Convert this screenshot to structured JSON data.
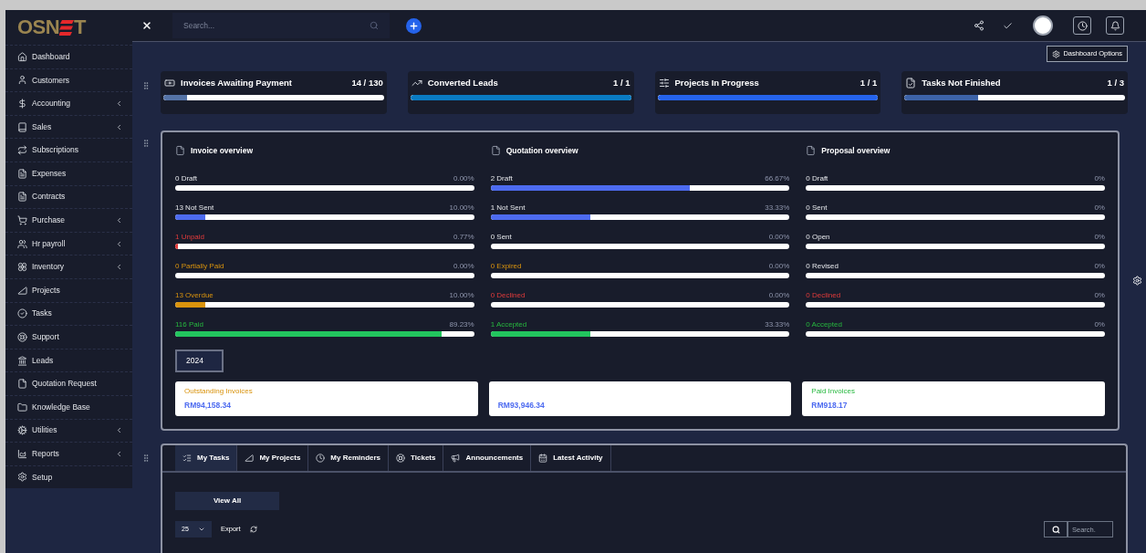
{
  "logo": {
    "left": "OSN",
    "right": "T"
  },
  "sidebar": {
    "items": [
      {
        "label": "Dashboard",
        "has_submenu": false
      },
      {
        "label": "Customers",
        "has_submenu": false
      },
      {
        "label": "Accounting",
        "has_submenu": true
      },
      {
        "label": "Sales",
        "has_submenu": true
      },
      {
        "label": "Subscriptions",
        "has_submenu": false
      },
      {
        "label": "Expenses",
        "has_submenu": false
      },
      {
        "label": "Contracts",
        "has_submenu": false
      },
      {
        "label": "Purchase",
        "has_submenu": true
      },
      {
        "label": "Hr payroll",
        "has_submenu": true
      },
      {
        "label": "Inventory",
        "has_submenu": true
      },
      {
        "label": "Projects",
        "has_submenu": false
      },
      {
        "label": "Tasks",
        "has_submenu": false
      },
      {
        "label": "Support",
        "has_submenu": false
      },
      {
        "label": "Leads",
        "has_submenu": false
      },
      {
        "label": "Quotation Request",
        "has_submenu": false
      },
      {
        "label": "Knowledge Base",
        "has_submenu": false
      },
      {
        "label": "Utilities",
        "has_submenu": true
      },
      {
        "label": "Reports",
        "has_submenu": true
      },
      {
        "label": "Setup",
        "has_submenu": false
      }
    ]
  },
  "topbar": {
    "search": {
      "placeholder": "Search..."
    }
  },
  "dashboard_options": "Dashboard Options",
  "stat_cards": [
    {
      "title": "Invoices Awaiting Payment",
      "value": "14 / 130",
      "level": 0.108,
      "color": "#5573a6"
    },
    {
      "title": "Converted Leads",
      "value": "1 / 1",
      "level": 1,
      "color": "#0a7bc2"
    },
    {
      "title": "Projects In Progress",
      "value": "1 / 1",
      "level": 1,
      "color": "#2563eb"
    },
    {
      "title": "Tasks Not Finished",
      "value": "1 / 3",
      "level": 0.333,
      "color": "#3d63a8"
    }
  ],
  "overviews": [
    {
      "title": "Invoice overview",
      "rows": [
        {
          "label": "0 Draft",
          "percent": "0.00%",
          "level": 0,
          "kind": "default"
        },
        {
          "label": "13 Not Sent",
          "percent": "10.00%",
          "level": 0.1,
          "kind": "default"
        },
        {
          "label": "1 Unpaid",
          "percent": "0.77%",
          "level": 0.0077,
          "kind": "danger"
        },
        {
          "label": "0 Partially Paid",
          "percent": "0.00%",
          "level": 0,
          "kind": "warning"
        },
        {
          "label": "13 Overdue",
          "percent": "10.00%",
          "level": 0.1,
          "kind": "warning"
        },
        {
          "label": "116 Paid",
          "percent": "89.23%",
          "level": 0.8923,
          "kind": "success"
        }
      ]
    },
    {
      "title": "Quotation overview",
      "rows": [
        {
          "label": "2 Draft",
          "percent": "66.67%",
          "level": 0.6667,
          "kind": "default"
        },
        {
          "label": "1 Not Sent",
          "percent": "33.33%",
          "level": 0.3333,
          "kind": "default"
        },
        {
          "label": "0 Sent",
          "percent": "0.00%",
          "level": 0,
          "kind": "default"
        },
        {
          "label": "0 Expired",
          "percent": "0.00%",
          "level": 0,
          "kind": "warning"
        },
        {
          "label": "0 Declined",
          "percent": "0.00%",
          "level": 0,
          "kind": "danger"
        },
        {
          "label": "1 Accepted",
          "percent": "33.33%",
          "level": 0.3333,
          "kind": "success"
        }
      ]
    },
    {
      "title": "Proposal overview",
      "rows": [
        {
          "label": "0 Draft",
          "percent": "0%",
          "level": 0,
          "kind": "default"
        },
        {
          "label": "0 Sent",
          "percent": "0%",
          "level": 0,
          "kind": "default"
        },
        {
          "label": "0 Open",
          "percent": "0%",
          "level": 0,
          "kind": "default"
        },
        {
          "label": "0 Revised",
          "percent": "0%",
          "level": 0,
          "kind": "default"
        },
        {
          "label": "0 Declined",
          "percent": "0%",
          "level": 0,
          "kind": "danger"
        },
        {
          "label": "0 Accepted",
          "percent": "0%",
          "level": 0,
          "kind": "success"
        }
      ]
    }
  ],
  "year": "2024",
  "totals": [
    {
      "label": "Outstanding Invoices",
      "amount": "RM94,158.34",
      "kind": "warning"
    },
    {
      "amount": "RM93,946.34"
    },
    {
      "label": "Paid Invoices",
      "amount": "RM918.17",
      "kind": "success"
    }
  ],
  "tabs": [
    {
      "label": "My Tasks",
      "selected": true
    },
    {
      "label": "My Projects",
      "selected": false
    },
    {
      "label": "My Reminders",
      "selected": false
    },
    {
      "label": "Tickets",
      "selected": false
    },
    {
      "label": "Announcements",
      "selected": false
    },
    {
      "label": "Latest Activity",
      "selected": false
    }
  ],
  "view_all": "View All",
  "per_page": "25",
  "export": "Export",
  "table_search": {
    "placeholder": "Search."
  }
}
